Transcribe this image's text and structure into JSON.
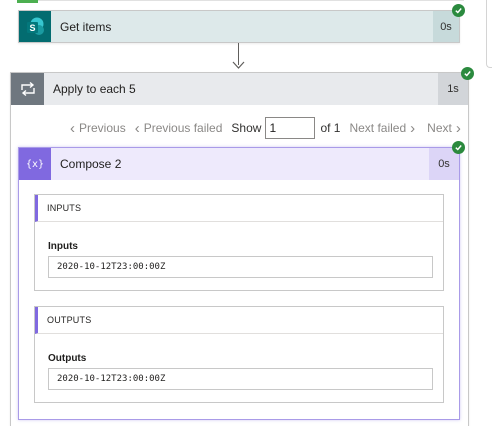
{
  "get_items": {
    "title": "Get items",
    "duration": "0s",
    "icon_letter": "S",
    "icon": "sharepoint-icon"
  },
  "apply_each": {
    "title": "Apply to each 5",
    "duration": "1s",
    "icon": "loop-icon"
  },
  "pager": {
    "previous_label": "Previous",
    "previous_failed_label": "Previous failed",
    "show_label": "Show",
    "page_value": "1",
    "of_label": "of 1",
    "next_failed_label": "Next failed",
    "next_label": "Next"
  },
  "compose": {
    "title": "Compose 2",
    "duration": "0s",
    "icon_text": "{x}",
    "inputs": {
      "header": "INPUTS",
      "label": "Inputs",
      "value": "2020-10-12T23:00:00Z"
    },
    "outputs": {
      "header": "OUTPUTS",
      "label": "Outputs",
      "value": "2020-10-12T23:00:00Z"
    }
  },
  "colors": {
    "success_green": "#2b8a3e",
    "sharepoint_teal": "#036c70",
    "compose_purple": "#8069e0",
    "loop_gray": "#6f777f"
  }
}
